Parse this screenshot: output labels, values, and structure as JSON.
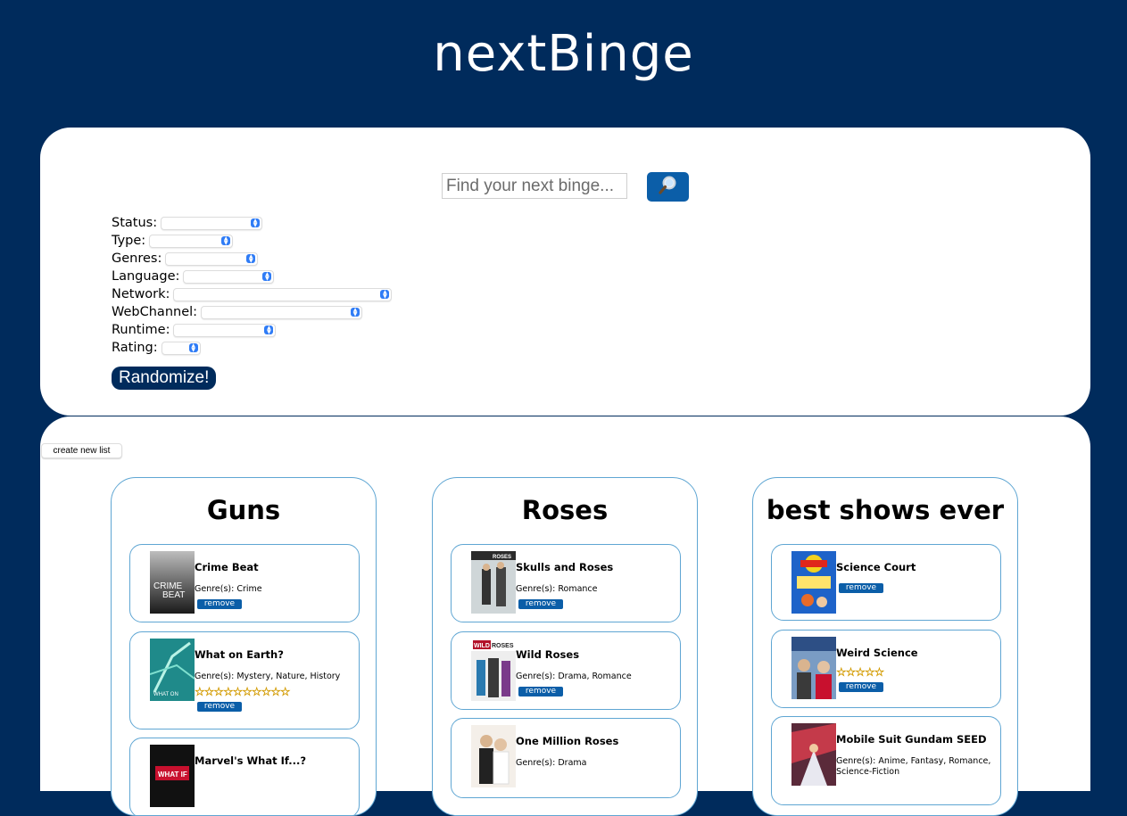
{
  "app": {
    "title": "nextBinge"
  },
  "search": {
    "placeholder": "Find your next binge...",
    "button_icon": "magnifier-icon"
  },
  "filters": [
    {
      "label": "Status:"
    },
    {
      "label": "Type:"
    },
    {
      "label": "Genres:"
    },
    {
      "label": "Language:"
    },
    {
      "label": "Network:"
    },
    {
      "label": "WebChannel:"
    },
    {
      "label": "Runtime:"
    },
    {
      "label": "Rating:"
    }
  ],
  "randomize_label": "Randomize!",
  "create_list_label": "create new list",
  "colors": {
    "background": "#002b5c",
    "accent": "#0b5ea8",
    "card_border": "#5fa6d3"
  },
  "lists": [
    {
      "title": "Guns",
      "shows": [
        {
          "name": "Crime Beat",
          "genres": "Genre(s): Crime",
          "stars": "",
          "remove": "remove",
          "poster": "crime-beat"
        },
        {
          "name": "What on Earth?",
          "genres": "Genre(s): Mystery, Nature, History",
          "stars": "☆☆☆☆☆☆☆☆☆☆",
          "remove": "remove",
          "poster": "what-on-earth"
        },
        {
          "name": "Marvel's What If...?",
          "genres": "",
          "stars": "",
          "remove": "",
          "poster": "what-if"
        }
      ]
    },
    {
      "title": "Roses",
      "shows": [
        {
          "name": "Skulls and Roses",
          "genres": "Genre(s): Romance",
          "stars": "",
          "remove": "remove",
          "poster": "skulls-roses"
        },
        {
          "name": "Wild Roses",
          "genres": "Genre(s): Drama, Romance",
          "stars": "",
          "remove": "remove",
          "poster": "wild-roses"
        },
        {
          "name": "One Million Roses",
          "genres": "Genre(s): Drama",
          "stars": "",
          "remove": "",
          "poster": "million-roses"
        }
      ]
    },
    {
      "title": "best shows ever",
      "shows": [
        {
          "name": "Science Court",
          "genres": "",
          "stars": "",
          "remove": "remove",
          "poster": "science-court"
        },
        {
          "name": "Weird Science",
          "genres": "",
          "stars": "☆☆☆☆☆",
          "remove": "remove",
          "poster": "weird-science"
        },
        {
          "name": "Mobile Suit Gundam SEED",
          "genres": "Genre(s): Anime, Fantasy, Romance, Science-Fiction",
          "stars": "",
          "remove": "",
          "poster": "gundam-seed"
        }
      ]
    }
  ]
}
